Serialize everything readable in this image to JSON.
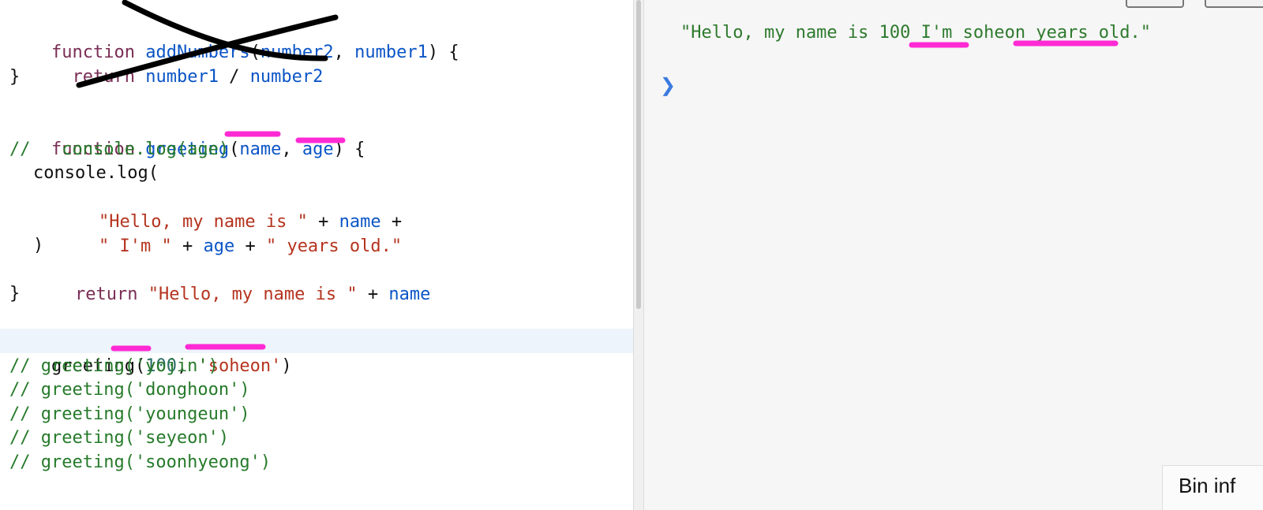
{
  "editor": {
    "code": {
      "l1": {
        "kw": "function",
        "fn": "addNumbers",
        "p1": "(",
        "a1": "number2",
        "p2": ", ",
        "a2": "number1",
        "p3": ") {"
      },
      "l2": {
        "kw": "return",
        "a1": "number1",
        "op": " / ",
        "a2": "number2"
      },
      "l3": "}",
      "l4": {
        "kw": "function",
        "fn": "greeting",
        "p1": "(",
        "a1": "name",
        "p2": ", ",
        "a2": "age",
        "p3": ") {"
      },
      "l5": "//   console.log(age)",
      "l6": "console.log(",
      "l7": {
        "s1": "\"Hello, my name is \"",
        "op": " + ",
        "v": "name",
        "op2": " +"
      },
      "l8": {
        "s1": "\" I'm \"",
        "op1": " + ",
        "v": "age",
        "op2": " + ",
        "s2": "\" years old.\""
      },
      "l9": ")",
      "l10": {
        "kw": "return",
        "s1": "\"Hello, my name is \"",
        "op": " + ",
        "v": "name"
      },
      "l11": "}",
      "l12": {
        "fn": "greeting",
        "p1": "(",
        "n": "100",
        "p2": ", ",
        "s": "'soheon'",
        "p3": ")"
      },
      "c1": "// greeting('yojin')",
      "c2": "// greeting('donghoon')",
      "c3": "// greeting('youngeun')",
      "c4": "// greeting('seyeon')",
      "c5": "// greeting('soonhyeong')"
    }
  },
  "console": {
    "output": "\"Hello, my name is 100 I'm soheon years old.\"",
    "prompt_icon": "chevron-right-icon"
  },
  "bin_label": "Bin inf",
  "colors": {
    "annotation_magenta": "#ff2ad4",
    "keyword": "#7a2d55",
    "function": "#0b55c6",
    "string": "#b5341f",
    "comment": "#267a2a"
  }
}
